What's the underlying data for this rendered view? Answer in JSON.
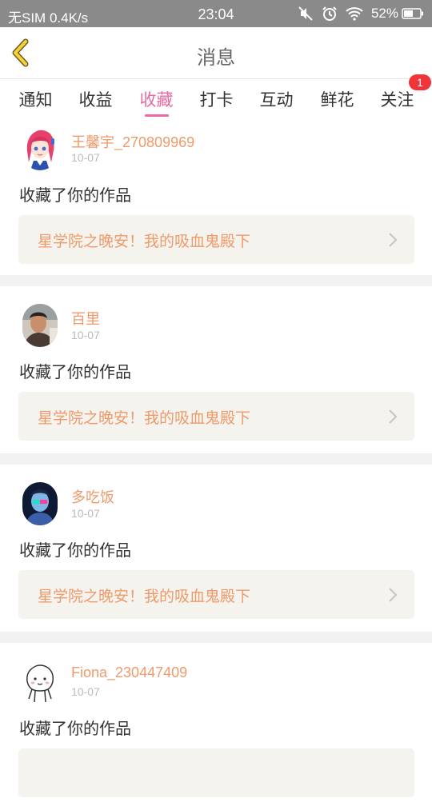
{
  "status_bar": {
    "carrier": "无SIM 0.4K/s",
    "time": "23:04",
    "battery": "52%"
  },
  "header": {
    "title": "消息"
  },
  "tabs": [
    {
      "label": "通知",
      "active": false
    },
    {
      "label": "收益",
      "active": false
    },
    {
      "label": "收藏",
      "active": true
    },
    {
      "label": "打卡",
      "active": false
    },
    {
      "label": "互动",
      "active": false
    },
    {
      "label": "鲜花",
      "active": false
    },
    {
      "label": "关注",
      "active": false
    }
  ],
  "follow_badge": "1",
  "colors": {
    "accent": "#e86aa0",
    "username": "#ef9a6a",
    "badge": "#f0353a"
  },
  "items": [
    {
      "username": "王馨宇_270809969",
      "date": "10-07",
      "action": "收藏了你的作品",
      "work_title": "星学院之晚安！我的吸血鬼殿下",
      "avatar": "anime-girl-avatar"
    },
    {
      "username": "百里",
      "date": "10-07",
      "action": "收藏了你的作品",
      "work_title": "星学院之晚安！我的吸血鬼殿下",
      "avatar": "photo-avatar"
    },
    {
      "username": "多吃饭",
      "date": "10-07",
      "action": "收藏了你的作品",
      "work_title": "星学院之晚安！我的吸血鬼殿下",
      "avatar": "neon-portrait-avatar"
    },
    {
      "username": "Fiona_230447409",
      "date": "10-07",
      "action": "收藏了你的作品",
      "work_title": "",
      "avatar": "cartoon-doodle-avatar"
    }
  ]
}
